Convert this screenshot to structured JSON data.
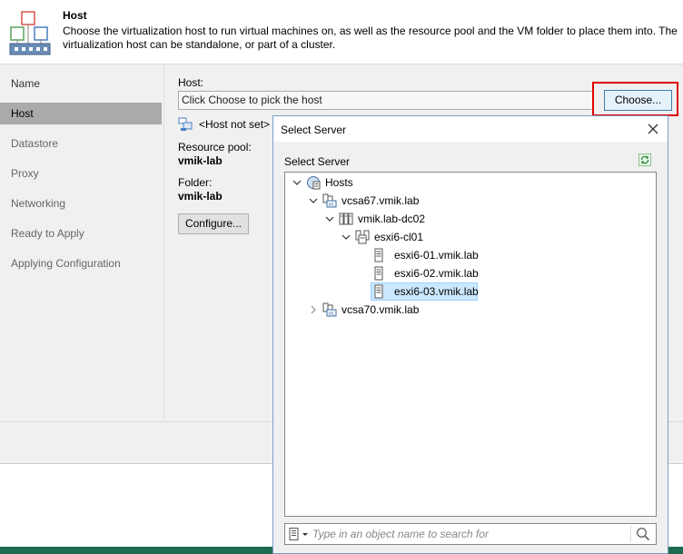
{
  "header": {
    "title": "Host",
    "description": "Choose the virtualization host to run virtual machines on, as well as the resource pool and the VM folder to place them into. The virtualization host can be standalone, or part of a cluster."
  },
  "nav": {
    "items": [
      {
        "label": "Name"
      },
      {
        "label": "Host"
      },
      {
        "label": "Datastore"
      },
      {
        "label": "Proxy"
      },
      {
        "label": "Networking"
      },
      {
        "label": "Ready to Apply"
      },
      {
        "label": "Applying Configuration"
      }
    ],
    "active_index": 1
  },
  "main": {
    "host_label": "Host:",
    "host_value": "Click Choose to pick the host",
    "choose_label": "Choose...",
    "host_not_set": "<Host not set>",
    "resource_pool_label": "Resource pool:",
    "resource_pool_value": "vmik-lab",
    "folder_label": "Folder:",
    "folder_value": "vmik-lab",
    "configure_label": "Configure..."
  },
  "dialog": {
    "title": "Select Server",
    "section_label": "Select Server",
    "tree": [
      {
        "label": "Hosts",
        "icon": "hosts-icon",
        "expanded": true
      },
      {
        "label": "vcsa67.vmik.lab",
        "icon": "vcenter-icon",
        "expanded": true
      },
      {
        "label": "vmik.lab-dc02",
        "icon": "datacenter-icon",
        "expanded": true
      },
      {
        "label": "esxi6-cl01",
        "icon": "cluster-icon",
        "expanded": true
      },
      {
        "label": "esxi6-01.vmik.lab",
        "icon": "server-icon"
      },
      {
        "label": "esxi6-02.vmik.lab",
        "icon": "server-icon"
      },
      {
        "label": "esxi6-03.vmik.lab",
        "icon": "server-icon",
        "selected": true
      },
      {
        "label": "vcsa70.vmik.lab",
        "icon": "vcenter-icon",
        "expanded": false
      }
    ],
    "search_placeholder": "Type in an object name to search for"
  },
  "colors": {
    "highlight_border": "#e00000",
    "selection_background": "#cce8ff",
    "footer_bar": "#1f6b50"
  }
}
